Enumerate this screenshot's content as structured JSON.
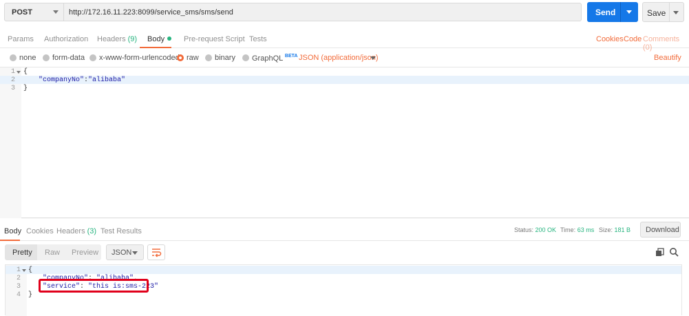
{
  "request": {
    "method": "POST",
    "url": "http://172.16.11.223:8099/service_sms/sms/send",
    "send_label": "Send",
    "save_label": "Save"
  },
  "request_tabs": {
    "params": "Params",
    "authorization": "Authorization",
    "headers": "Headers",
    "headers_count": "(9)",
    "body": "Body",
    "pre_request": "Pre-request Script",
    "tests": "Tests",
    "cookies": "Cookies",
    "code": "Code",
    "comments": "Comments (0)"
  },
  "body_types": {
    "none": "none",
    "form_data": "form-data",
    "urlencoded": "x-www-form-urlencoded",
    "raw": "raw",
    "binary": "binary",
    "graphql": "GraphQL",
    "beta": "BETA",
    "content_type": "JSON (application/json)",
    "beautify": "Beautify",
    "selected": "raw"
  },
  "request_body": {
    "lines": [
      "1",
      "2",
      "3"
    ],
    "line1": "{",
    "line2_key": "\"companyNo\"",
    "line2_colon": ":",
    "line2_value": "\"alibaba\"",
    "line3": "}"
  },
  "response_tabs": {
    "body": "Body",
    "cookies": "Cookies",
    "headers": "Headers",
    "headers_count": "(3)",
    "test_results": "Test Results",
    "status_label": "Status:",
    "status_value": "200 OK",
    "time_label": "Time:",
    "time_value": "63 ms",
    "size_label": "Size:",
    "size_value": "181 B",
    "download": "Download"
  },
  "response_toolbar": {
    "pretty": "Pretty",
    "raw": "Raw",
    "preview": "Preview",
    "format": "JSON"
  },
  "response_body": {
    "lines": [
      "1",
      "2",
      "3",
      "4"
    ],
    "line1": "{",
    "line2_key": "\"companyNo\"",
    "line2_sep": ": ",
    "line2_value": "\"alibaba\"",
    "line2_end": ",",
    "line3_key": "\"service\"",
    "line3_sep": ": ",
    "line3_value": "\"this is:sms-223\"",
    "line4": "}"
  },
  "colors": {
    "accent": "#f26b3a",
    "send": "#1578e8",
    "success": "#26b47f",
    "annotation": "#e0001b"
  }
}
